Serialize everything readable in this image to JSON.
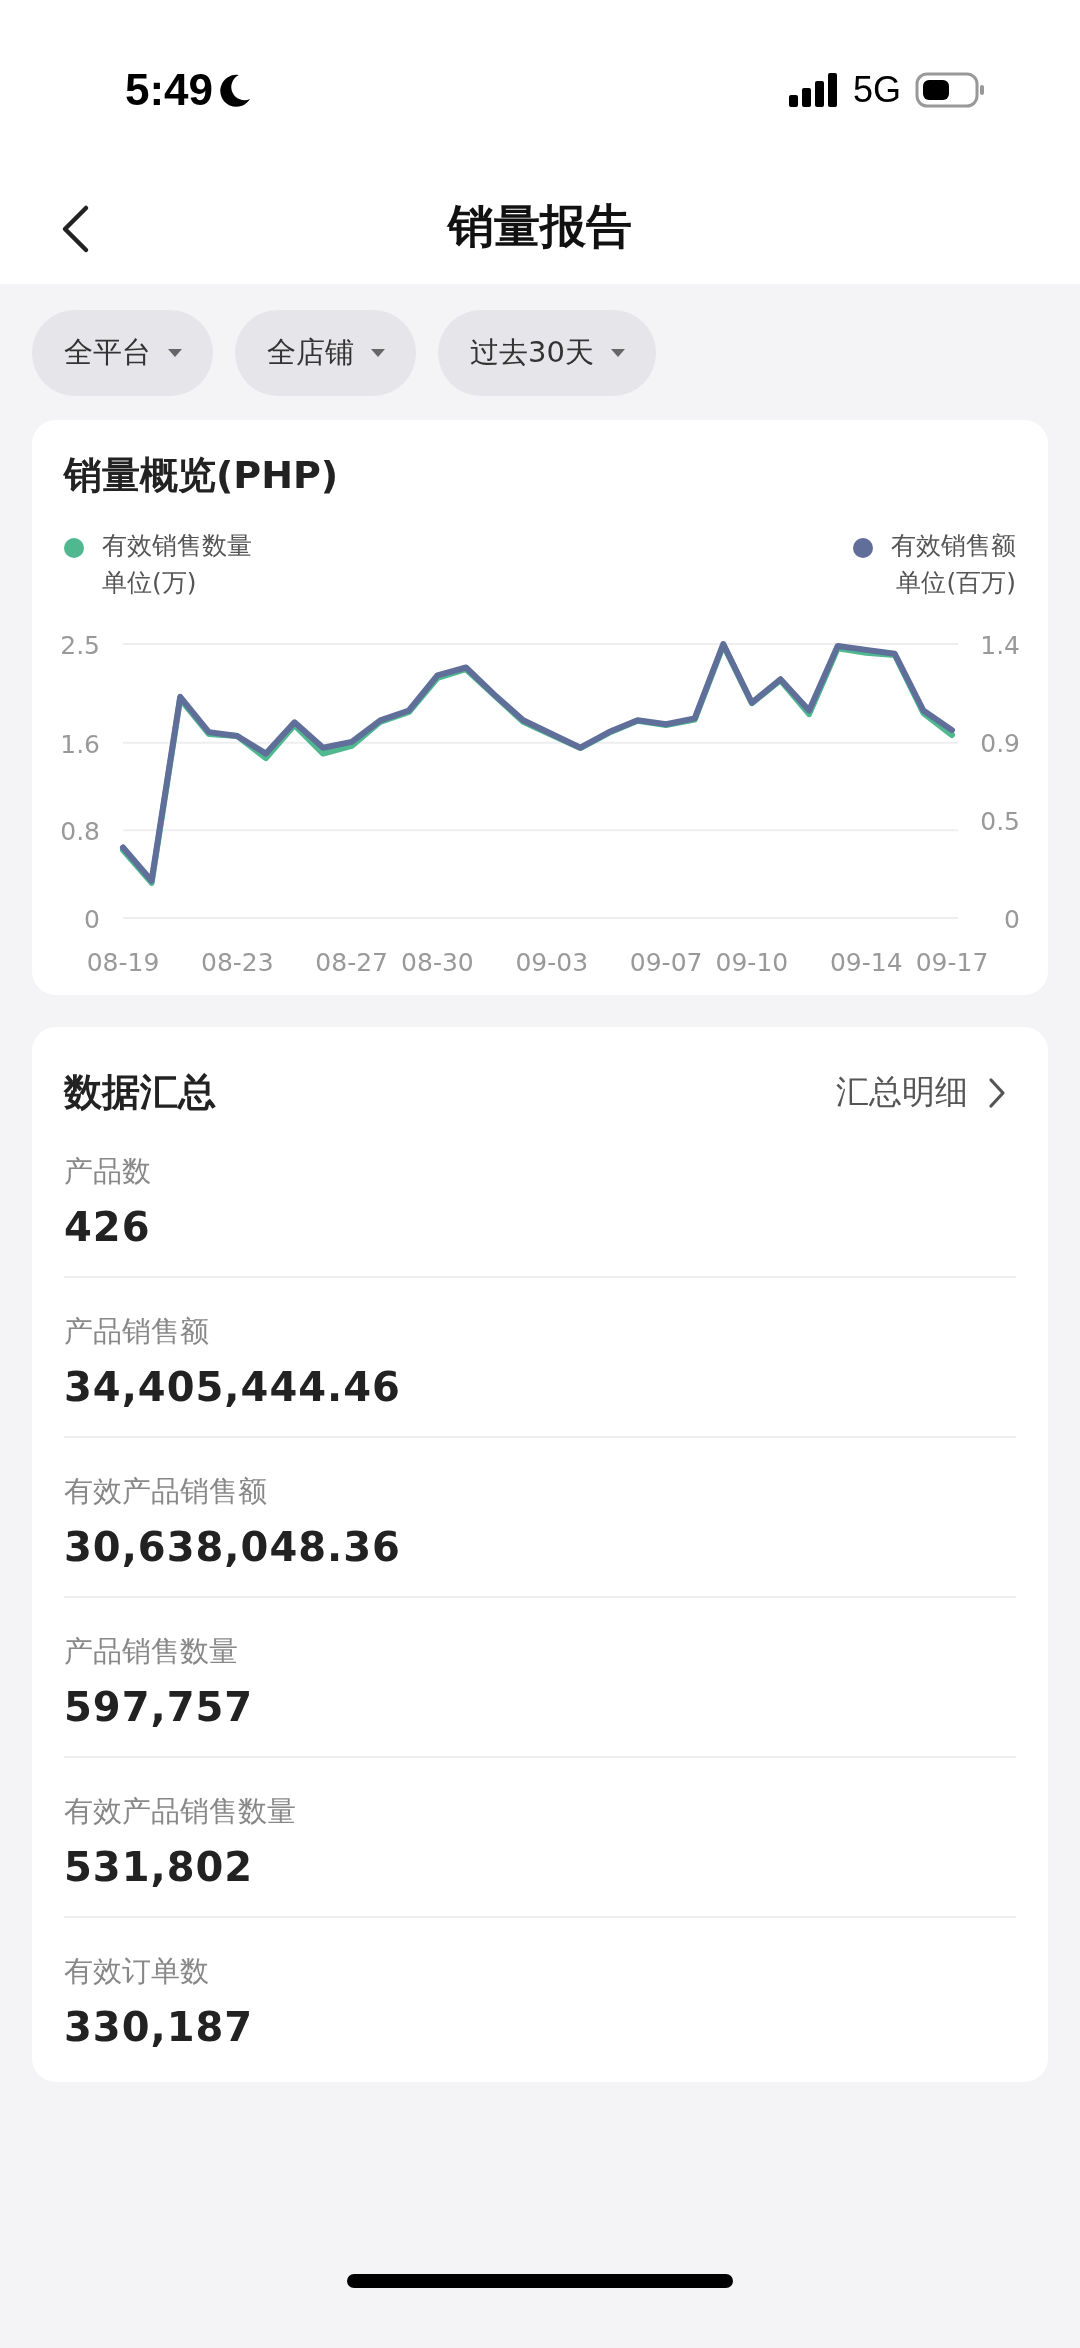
{
  "status_bar": {
    "time": "5:49",
    "network": "5G"
  },
  "header": {
    "title": "销量报告"
  },
  "filters": [
    {
      "label": "全平台"
    },
    {
      "label": "全店铺"
    },
    {
      "label": "过去30天"
    }
  ],
  "overview": {
    "title": "销量概览(PHP)",
    "units": [
      "单位(万)",
      "单位(百万)"
    ],
    "chart_data": {
      "type": "line",
      "categories": [
        "08-19",
        null,
        null,
        null,
        "08-23",
        null,
        null,
        null,
        "08-27",
        null,
        null,
        "08-30",
        null,
        null,
        null,
        "09-03",
        null,
        null,
        null,
        "09-07",
        null,
        null,
        "09-10",
        null,
        null,
        null,
        "09-14",
        null,
        null,
        "09-17"
      ],
      "ylim": [
        0,
        2.5
      ],
      "yticks": [
        0,
        0.8,
        1.6,
        2.5
      ],
      "y2lim": [
        0,
        1.4
      ],
      "y2ticks": [
        0,
        0.5,
        0.9,
        1.4
      ],
      "series": [
        {
          "name": "有效销售数量",
          "color": "#4fb88f",
          "values": [
            0.62,
            0.32,
            2.0,
            1.68,
            1.66,
            1.46,
            1.76,
            1.5,
            1.57,
            1.79,
            1.88,
            2.19,
            2.27,
            2.03,
            1.79,
            1.67,
            1.55,
            1.69,
            1.8,
            1.76,
            1.81,
            2.49,
            1.96,
            2.17,
            1.86,
            2.46,
            2.42,
            2.4,
            1.87,
            1.67
          ]
        },
        {
          "name": "有效销售额",
          "axis": "y2",
          "color": "#5f6f99",
          "values": [
            0.36,
            0.19,
            1.13,
            0.95,
            0.93,
            0.84,
            1.0,
            0.87,
            0.9,
            1.01,
            1.06,
            1.24,
            1.28,
            1.14,
            1.01,
            0.94,
            0.87,
            0.95,
            1.01,
            0.99,
            1.02,
            1.4,
            1.1,
            1.22,
            1.06,
            1.39,
            1.37,
            1.35,
            1.06,
            0.96
          ]
        }
      ]
    }
  },
  "summary": {
    "title": "数据汇总",
    "link": "汇总明细",
    "metrics": [
      {
        "label": "产品数",
        "value": "426"
      },
      {
        "label": "产品销售额",
        "value": "34,405,444.46"
      },
      {
        "label": "有效产品销售额",
        "value": "30,638,048.36"
      },
      {
        "label": "产品销售数量",
        "value": "597,757"
      },
      {
        "label": "有效产品销售数量",
        "value": "531,802"
      },
      {
        "label": "有效订单数",
        "value": "330,187"
      }
    ]
  }
}
